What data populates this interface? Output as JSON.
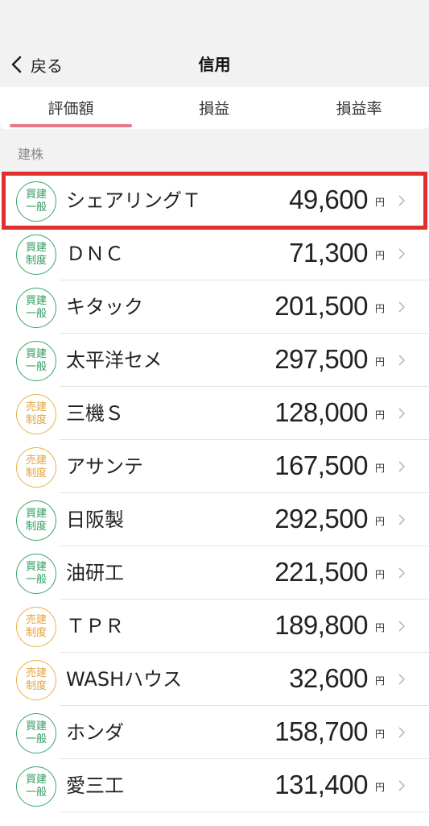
{
  "header": {
    "back_label": "戻る",
    "title": "信用"
  },
  "tabs": [
    "評価額",
    "損益",
    "損益率"
  ],
  "section_label": "建株",
  "currency": "円",
  "rows": [
    {
      "badge": [
        "買建",
        "一般"
      ],
      "type": "buy",
      "name": "シェアリングＴ",
      "amount": "49,600"
    },
    {
      "badge": [
        "買建",
        "制度"
      ],
      "type": "buy",
      "name": "ＤＮＣ",
      "amount": "71,300"
    },
    {
      "badge": [
        "買建",
        "一般"
      ],
      "type": "buy",
      "name": "キタック",
      "amount": "201,500"
    },
    {
      "badge": [
        "買建",
        "一般"
      ],
      "type": "buy",
      "name": "太平洋セメ",
      "amount": "297,500"
    },
    {
      "badge": [
        "売建",
        "制度"
      ],
      "type": "sell",
      "name": "三機Ｓ",
      "amount": "128,000"
    },
    {
      "badge": [
        "売建",
        "制度"
      ],
      "type": "sell",
      "name": "アサンテ",
      "amount": "167,500"
    },
    {
      "badge": [
        "買建",
        "制度"
      ],
      "type": "buy",
      "name": "日阪製",
      "amount": "292,500"
    },
    {
      "badge": [
        "買建",
        "一般"
      ],
      "type": "buy",
      "name": "油研工",
      "amount": "221,500"
    },
    {
      "badge": [
        "売建",
        "制度"
      ],
      "type": "sell",
      "name": "ＴＰＲ",
      "amount": "189,800"
    },
    {
      "badge": [
        "売建",
        "制度"
      ],
      "type": "sell",
      "name": "WASHハウス",
      "amount": "32,600"
    },
    {
      "badge": [
        "買建",
        "一般"
      ],
      "type": "buy",
      "name": "ホンダ",
      "amount": "158,700"
    },
    {
      "badge": [
        "買建",
        "一般"
      ],
      "type": "buy",
      "name": "愛三工",
      "amount": "131,400"
    }
  ],
  "colors": {
    "buy": "#3aa56a",
    "sell": "#eab04a",
    "tab_underline": "#e8798a",
    "highlight": "#e0302e"
  }
}
